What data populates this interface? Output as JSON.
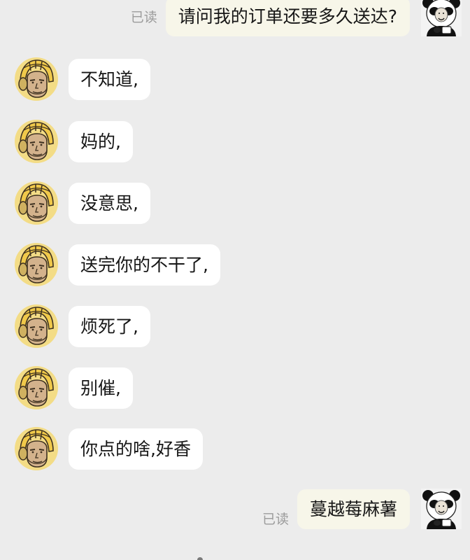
{
  "conversation": {
    "outgoing": [
      {
        "read_status": "已读",
        "text": "请问我的订单还要多久送达?",
        "avatar_icon": "panda-meme-avatar-icon"
      },
      {
        "read_status": "已读",
        "text": "蔓越莓麻薯",
        "avatar_icon": "panda-meme-avatar-icon"
      }
    ],
    "incoming": [
      {
        "text": "不知道,",
        "avatar_icon": "rider-helmet-avatar-icon"
      },
      {
        "text": "妈的,",
        "avatar_icon": "rider-helmet-avatar-icon"
      },
      {
        "text": "没意思,",
        "avatar_icon": "rider-helmet-avatar-icon"
      },
      {
        "text": "送完你的不干了,",
        "avatar_icon": "rider-helmet-avatar-icon"
      },
      {
        "text": "烦死了,",
        "avatar_icon": "rider-helmet-avatar-icon"
      },
      {
        "text": "别催,",
        "avatar_icon": "rider-helmet-avatar-icon"
      },
      {
        "text": "你点的啥,好香",
        "avatar_icon": "rider-helmet-avatar-icon"
      }
    ]
  },
  "colors": {
    "background": "#ececec",
    "incoming_bubble": "#ffffff",
    "outgoing_bubble": "#f7f6e9",
    "read_status": "#9b9b9b",
    "helmet_yellow": "#f0c94a"
  }
}
